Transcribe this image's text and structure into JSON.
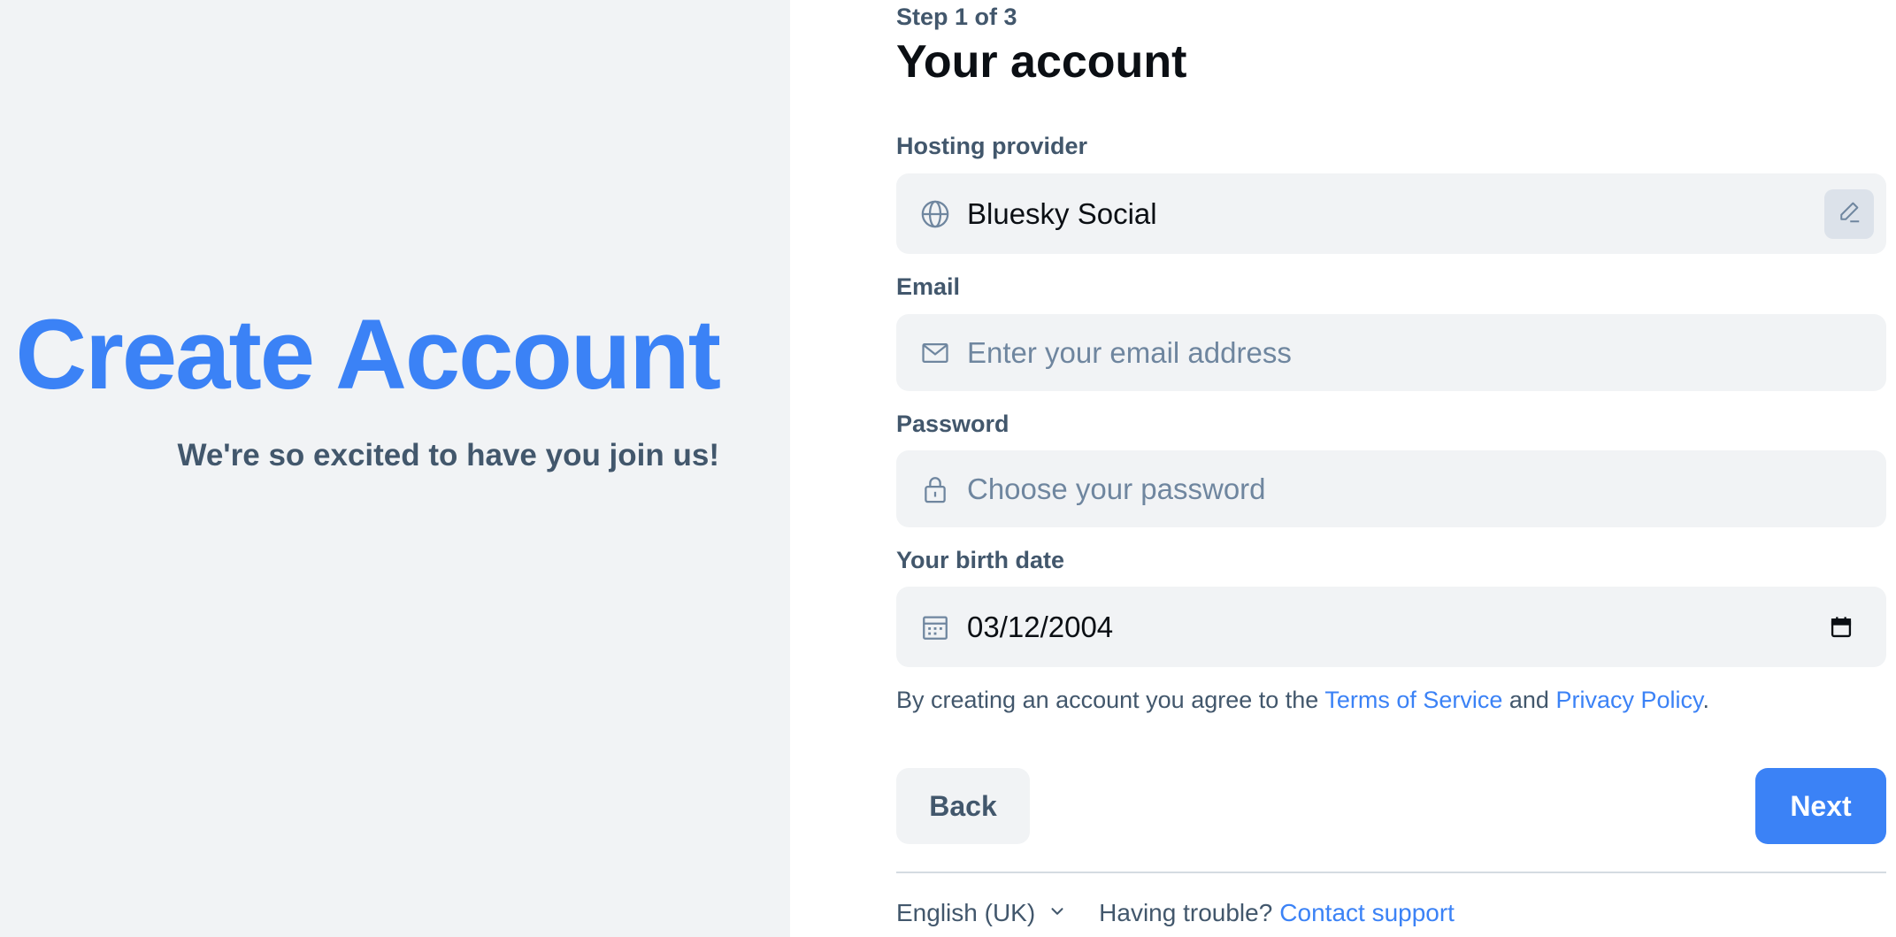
{
  "hero": {
    "title": "Create Account",
    "subtitle": "We're so excited to have you join us!"
  },
  "form": {
    "step": "Step 1 of 3",
    "title": "Your account",
    "hosting": {
      "label": "Hosting provider",
      "value": "Bluesky Social",
      "icon": "globe-icon",
      "action_icon": "pencil-icon"
    },
    "email": {
      "label": "Email",
      "placeholder": "Enter your email address",
      "value": "",
      "icon": "envelope-icon"
    },
    "password": {
      "label": "Password",
      "placeholder": "Choose your password",
      "value": "",
      "icon": "lock-icon"
    },
    "birthdate": {
      "label": "Your birth date",
      "value": "03/12/2004",
      "icon": "calendar-icon",
      "picker_icon": "calendar-picker-icon"
    },
    "terms": {
      "prefix": "By creating an account you agree to the ",
      "tos_link": "Terms of Service",
      "middle": " and ",
      "privacy_link": "Privacy Policy",
      "suffix": "."
    },
    "back_label": "Back",
    "next_label": "Next"
  },
  "footer": {
    "language": "English (UK)",
    "trouble_text": "Having trouble?",
    "support_link": "Contact support"
  },
  "colors": {
    "accent": "#3b82f6",
    "panel_bg": "#f1f3f5",
    "muted_text": "#42576c",
    "placeholder": "#6f869f"
  }
}
